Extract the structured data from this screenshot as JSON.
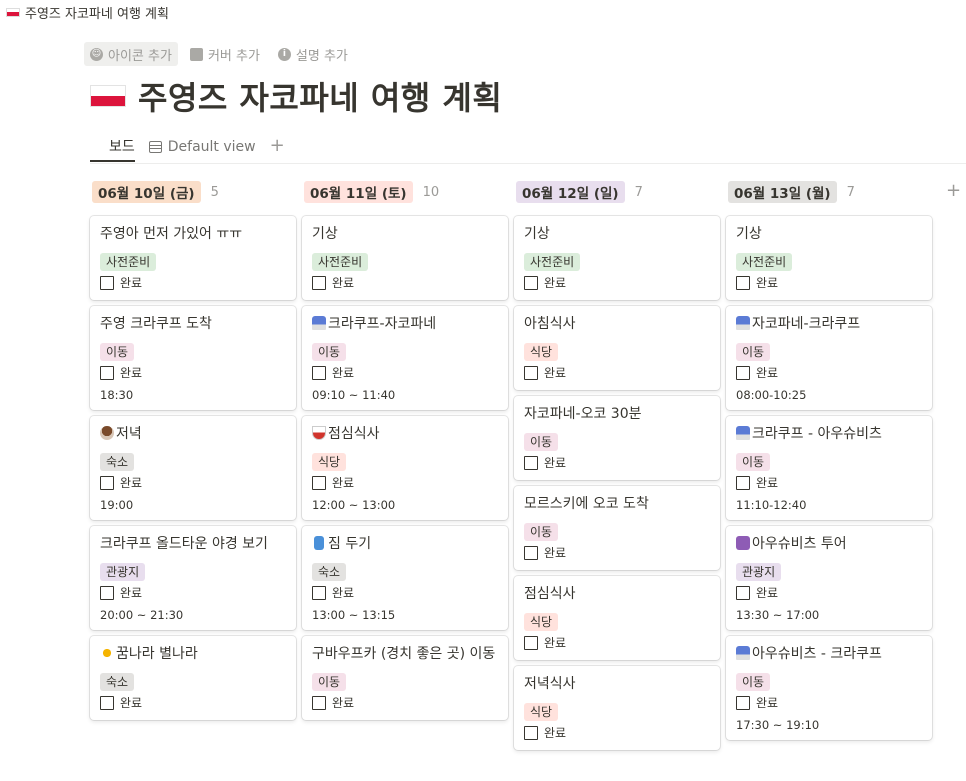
{
  "breadcrumb": {
    "title": "주영즈 자코파네 여행 계획"
  },
  "page_actions": {
    "add_icon": "아이콘 추가",
    "add_cover": "커버 추가",
    "add_description": "설명 추가"
  },
  "page": {
    "title": "주영즈 자코파네 여행 계획"
  },
  "tabs": {
    "board": "보드",
    "default_view": "Default view",
    "add": "+"
  },
  "board": {
    "add_group": "+",
    "columns": [
      {
        "label": "06월 10일 (금)",
        "count": "5",
        "color": "#fadec9",
        "cards": [
          {
            "title": "주영아 먼저 가있어 ㅠㅠ",
            "tag": "사전준비",
            "done": "완료",
            "time": ""
          },
          {
            "title": "주영 크라쿠프 도착",
            "tag": "이동",
            "done": "완료",
            "time": "18:30"
          },
          {
            "title": "저녁",
            "tag": "숙소",
            "done": "완료",
            "time": "19:00"
          },
          {
            "title": "크라쿠프 올드타운 야경 보기",
            "tag": "관광지",
            "done": "완료",
            "time": "20:00 ~ 21:30"
          },
          {
            "title": "꿈나라 별나라",
            "tag": "숙소",
            "done": "완료",
            "time": ""
          }
        ]
      },
      {
        "label": "06월 11일 (토)",
        "count": "10",
        "color": "#ffe2dd",
        "cards": [
          {
            "title": "기상",
            "tag": "사전준비",
            "done": "완료",
            "time": ""
          },
          {
            "title": "크라쿠프-자코파네",
            "tag": "이동",
            "done": "완료",
            "time": "09:10 ~ 11:40"
          },
          {
            "title": "점심식사",
            "tag": "식당",
            "done": "완료",
            "time": "12:00 ~ 13:00"
          },
          {
            "title": "짐 두기",
            "tag": "숙소",
            "done": "완료",
            "time": "13:00 ~ 13:15"
          },
          {
            "title": "구바우프카 (경치 좋은 곳) 이동",
            "tag": "이동",
            "done": "완료",
            "time": ""
          }
        ]
      },
      {
        "label": "06월 12일 (일)",
        "count": "7",
        "color": "#e8deee",
        "cards": [
          {
            "title": "기상",
            "tag": "사전준비",
            "done": "완료",
            "time": ""
          },
          {
            "title": "아침식사",
            "tag": "식당",
            "done": "완료",
            "time": ""
          },
          {
            "title": "자코파네-오코 30분",
            "tag": "이동",
            "done": "완료",
            "time": ""
          },
          {
            "title": "모르스키에 오코 도착",
            "tag": "이동",
            "done": "완료",
            "time": ""
          },
          {
            "title": "점심식사",
            "tag": "식당",
            "done": "완료",
            "time": ""
          },
          {
            "title": "저녁식사",
            "tag": "식당",
            "done": "완료",
            "time": ""
          }
        ]
      },
      {
        "label": "06월 13일 (월)",
        "count": "7",
        "color": "#e3e2e0",
        "cards": [
          {
            "title": "기상",
            "tag": "사전준비",
            "done": "완료",
            "time": ""
          },
          {
            "title": "자코파네-크라쿠프",
            "tag": "이동",
            "done": "완료",
            "time": "08:00-10:25"
          },
          {
            "title": "크라쿠프 - 아우슈비츠",
            "tag": "이동",
            "done": "완료",
            "time": "11:10-12:40"
          },
          {
            "title": "아우슈비츠 투어",
            "tag": "관광지",
            "done": "완료",
            "time": "13:30 ~ 17:00"
          },
          {
            "title": "아우슈비츠 - 크라쿠프",
            "tag": "이동",
            "done": "완료",
            "time": "17:30 ~ 19:10"
          }
        ]
      }
    ]
  },
  "tag_colors": {
    "사전준비": "#dbeddb",
    "이동": "#f5e0e9",
    "숙소": "#e3e2e0",
    "관광지": "#e8deee",
    "식당": "#ffe2dd"
  },
  "card_icons": {
    "0-2": "coffee-icon",
    "0-4": "star-icon",
    "1-1": "bus-icon",
    "1-2": "bowl-icon",
    "1-3": "luggage-icon",
    "3-1": "bus-icon",
    "3-2": "bus-icon",
    "3-3": "museum-icon",
    "3-4": "bus-icon"
  }
}
